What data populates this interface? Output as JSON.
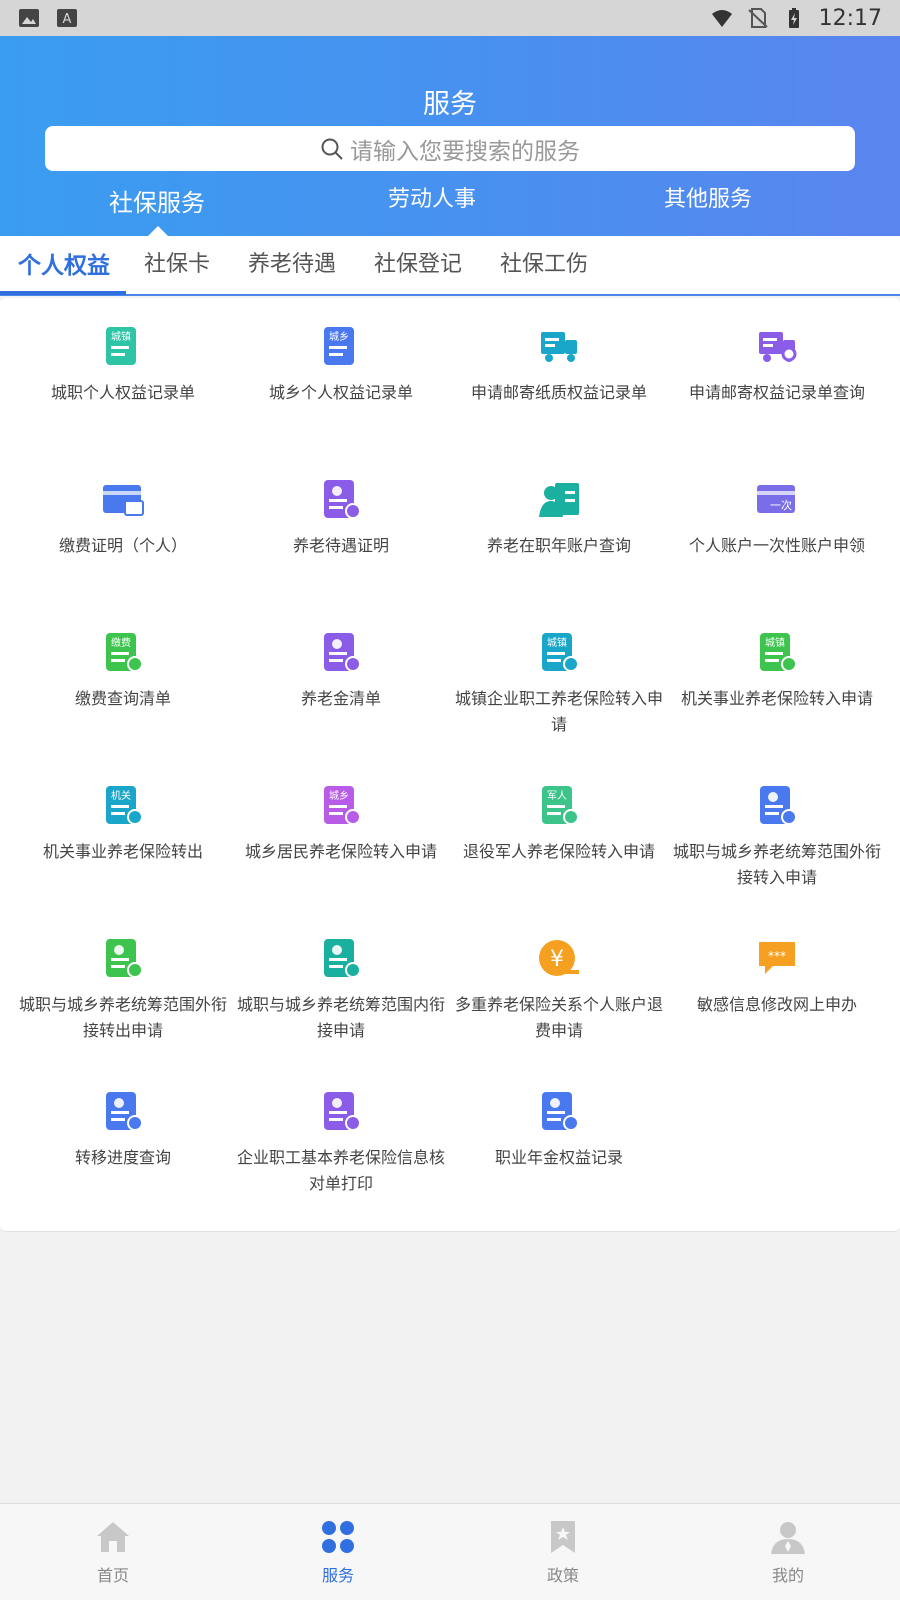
{
  "status_bar": {
    "time": "12:17"
  },
  "header": {
    "title": "服务",
    "search_placeholder": "请输入您要搜索的服务",
    "tabs": [
      {
        "label": "社保服务",
        "active": true
      },
      {
        "label": "劳动人事",
        "active": false
      },
      {
        "label": "其他服务",
        "active": false
      }
    ]
  },
  "sub_tabs": [
    {
      "label": "个人权益",
      "active": true
    },
    {
      "label": "社保卡",
      "active": false
    },
    {
      "label": "养老待遇",
      "active": false
    },
    {
      "label": "社保登记",
      "active": false
    },
    {
      "label": "社保工伤",
      "active": false
    }
  ],
  "services": [
    {
      "label": "城职个人权益记录单",
      "icon": "doc-icon",
      "color": "#2ec4a6",
      "badge": "城镇"
    },
    {
      "label": "城乡个人权益记录单",
      "icon": "doc-icon",
      "color": "#4a78ee",
      "badge": "城乡"
    },
    {
      "label": "申请邮寄纸质权益记录单",
      "icon": "truck-icon",
      "color": "#1aa6c8",
      "badge": ""
    },
    {
      "label": "申请邮寄权益记录单查询",
      "icon": "truck-search-icon",
      "color": "#8a5ce8",
      "badge": ""
    },
    {
      "label": "缴费证明（个人）",
      "icon": "card-print-icon",
      "color": "#4a78ee",
      "badge": ""
    },
    {
      "label": "养老待遇证明",
      "icon": "pension-print-icon",
      "color": "#8a5ce8",
      "badge": ""
    },
    {
      "label": "养老在职年账户查询",
      "icon": "worker-icon",
      "color": "#1ab0a0",
      "badge": ""
    },
    {
      "label": "个人账户一次性账户申领",
      "icon": "once-card-icon",
      "color": "#7a6ee8",
      "badge": "一次"
    },
    {
      "label": "缴费查询清单",
      "icon": "fee-print-icon",
      "color": "#3cc44e",
      "badge": "缴费"
    },
    {
      "label": "养老金清单",
      "icon": "pension-print-icon",
      "color": "#8a5ce8",
      "badge": ""
    },
    {
      "label": "城镇企业职工养老保险转入申请",
      "icon": "transfer-in-icon",
      "color": "#1aa6c8",
      "badge": "城镇"
    },
    {
      "label": "机关事业养老保险转入申请",
      "icon": "transfer-in-icon",
      "color": "#3cc44e",
      "badge": "城镇"
    },
    {
      "label": "机关事业养老保险转出",
      "icon": "transfer-out-icon",
      "color": "#1aa6c8",
      "badge": "机关"
    },
    {
      "label": "城乡居民养老保险转入申请",
      "icon": "transfer-in-icon",
      "color": "#b85ce8",
      "badge": "城乡"
    },
    {
      "label": "退役军人养老保险转入申请",
      "icon": "transfer-in-icon",
      "color": "#3cc48a",
      "badge": "军人"
    },
    {
      "label": "城职与城乡养老统筹范围外衔接转入申请",
      "icon": "cycle-in-icon",
      "color": "#4a78ee",
      "badge": ""
    },
    {
      "label": "城职与城乡养老统筹范围外衔接转出申请",
      "icon": "cycle-out-icon",
      "color": "#3cc44e",
      "badge": ""
    },
    {
      "label": "城职与城乡养老统筹范围内衔接申请",
      "icon": "edit-doc-icon",
      "color": "#1ab0a0",
      "badge": ""
    },
    {
      "label": "多重养老保险关系个人账户退费申请",
      "icon": "yuan-icon",
      "color": "#f5a020",
      "badge": ""
    },
    {
      "label": "敏感信息修改网上申办",
      "icon": "chat-icon",
      "color": "#f5a020",
      "badge": ""
    },
    {
      "label": "转移进度查询",
      "icon": "clock-doc-icon",
      "color": "#4a78ee",
      "badge": ""
    },
    {
      "label": "企业职工基本养老保险信息核对单打印",
      "icon": "check-doc-icon",
      "color": "#8a5ce8",
      "badge": ""
    },
    {
      "label": "职业年金权益记录",
      "icon": "search-doc-icon",
      "color": "#4a78ee",
      "badge": ""
    }
  ],
  "bottom_nav": [
    {
      "label": "首页",
      "icon": "home-icon",
      "active": false
    },
    {
      "label": "服务",
      "icon": "services-icon",
      "active": true
    },
    {
      "label": "政策",
      "icon": "policy-icon",
      "active": false
    },
    {
      "label": "我的",
      "icon": "profile-icon",
      "active": false
    }
  ],
  "colors": {
    "primary": "#2f6fe0",
    "header_start": "#3a9df0",
    "header_end": "#5a85ee"
  }
}
